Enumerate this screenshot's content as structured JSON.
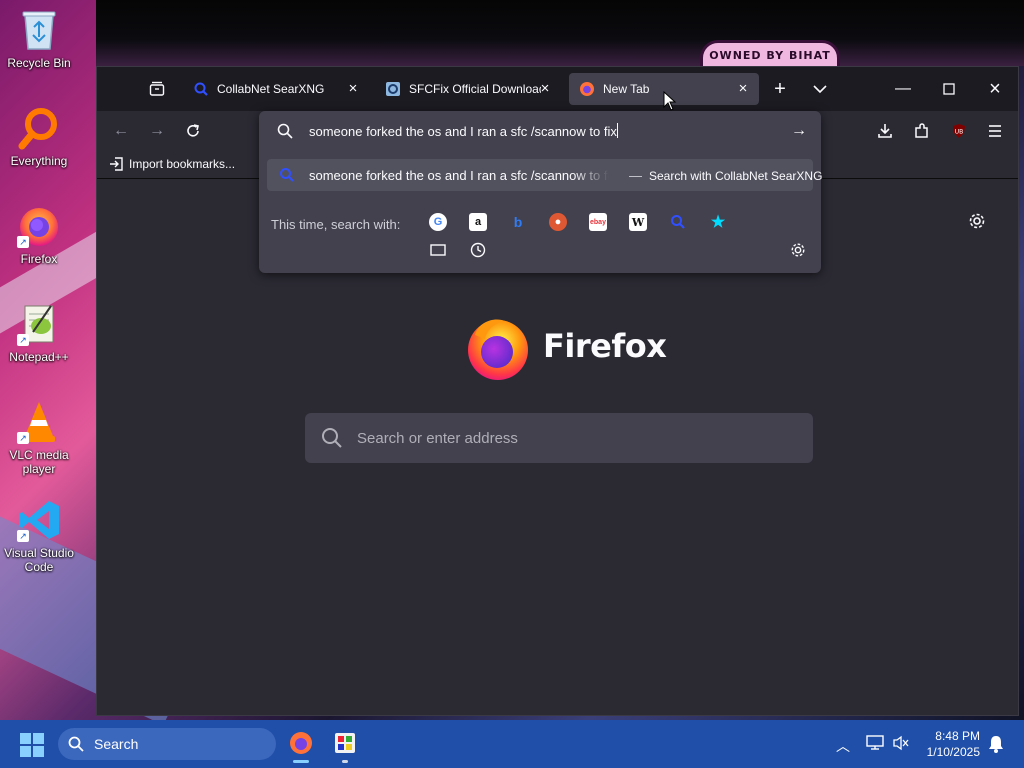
{
  "desktop": {
    "wallpaper_badge": "OWNED BY BIHAT",
    "icons": [
      {
        "label": "Recycle Bin",
        "icon": "recycle-bin-icon"
      },
      {
        "label": "Everything",
        "icon": "everything-search-icon"
      },
      {
        "label": "Firefox",
        "icon": "firefox-icon"
      },
      {
        "label": "Notepad++",
        "icon": "notepad-plus-plus-icon"
      },
      {
        "label": "VLC media player",
        "icon": "vlc-icon"
      },
      {
        "label": "Visual Studio Code",
        "icon": "vscode-icon"
      }
    ]
  },
  "browser": {
    "tabs": [
      {
        "label": "CollabNet SearXNG",
        "active": false,
        "favicon": "searxng-icon"
      },
      {
        "label": "SFCFix Official Download",
        "active": false,
        "favicon": "sfcfix-icon"
      },
      {
        "label": "New Tab",
        "active": true,
        "favicon": "firefox-icon"
      }
    ],
    "bookmarks_bar": {
      "import_label": "Import bookmarks..."
    },
    "urlbar": {
      "query": "someone forked the os and I ran a sfc /scannow to fix",
      "suggestion_text": "someone forked the os and I ran a sfc /scannow to fix",
      "suggestion_separator": "—",
      "suggestion_action": "Search with CollabNet SearXNG",
      "oneoff_label": "This time, search with:",
      "engines": [
        "google",
        "amazon",
        "bing",
        "duckduckgo",
        "ebay",
        "wikipedia",
        "searxng",
        "bookmarks",
        "tabs",
        "history"
      ]
    },
    "newtab": {
      "brand": "Firefox",
      "search_placeholder": "Search or enter address"
    }
  },
  "taskbar": {
    "search_label": "Search",
    "time": "8:48 PM",
    "date": "1/10/2025"
  },
  "colors": {
    "browser_bg": "#1c1b22",
    "toolbar_bg": "#2b2a33",
    "panel_bg": "#42414d",
    "taskbar_bg": "#1f4fa8"
  }
}
